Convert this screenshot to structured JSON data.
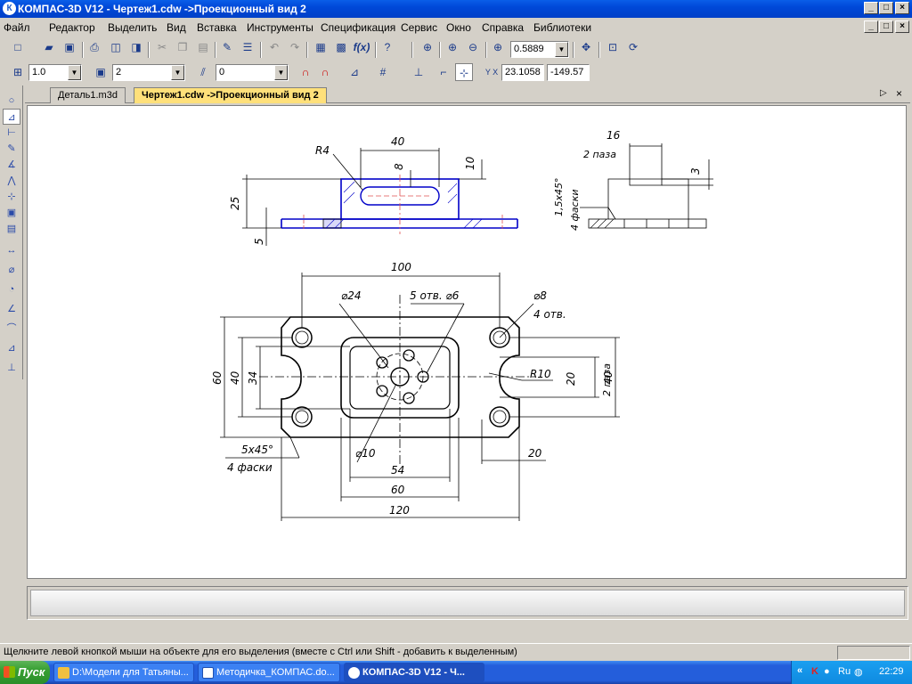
{
  "titlebar": {
    "title": "КОМПАС-3D V12 - Чертеж1.cdw ->Проекционный вид 2",
    "app_icon": "К",
    "min": "_",
    "max": "□",
    "close": "×"
  },
  "menu": [
    "Файл",
    "Редактор",
    "Выделить",
    "Вид",
    "Вставка",
    "Инструменты",
    "Спецификация",
    "Сервис",
    "Окно",
    "Справка",
    "Библиотеки"
  ],
  "toolbar": {
    "zoom_value": "0.5889"
  },
  "props": {
    "line_scale": "1.0",
    "layer": "2",
    "style": "0",
    "coord_x": "23.1058",
    "coord_y": "-149.57"
  },
  "tabs": [
    {
      "label": "Деталь1.m3d",
      "active": false
    },
    {
      "label": "Чертеж1.cdw ->Проекционный вид 2",
      "active": true
    }
  ],
  "drawing": {
    "front": {
      "d40": "40",
      "d8": "8",
      "d10": "10",
      "d25": "25",
      "d5": "5",
      "r4": "R4"
    },
    "side": {
      "d16": "16",
      "d2paza": "2 паза",
      "d3": "3",
      "chamfer": "1,5х45°",
      "chamfer_n": "4 фаски"
    },
    "plan": {
      "d100": "100",
      "d24": "⌀24",
      "holes6": "5 отв. ⌀6",
      "d8": "⌀8",
      "holes8": "4 отв.",
      "r10": "R10",
      "d20": "20",
      "paza": "2 паза",
      "d40r": "40",
      "d60": "60",
      "d40l": "40",
      "d34": "34",
      "chamfer": "5х45°",
      "chamfer_n": "4 фаски",
      "d10": "⌀10",
      "d20b": "20",
      "d54": "54",
      "d60b": "60",
      "d120": "120"
    }
  },
  "status": {
    "hint": "Щелкните левой кнопкой мыши на объекте для его выделения (вместе с Ctrl или Shift - добавить к выделенным)"
  },
  "taskbar": {
    "start": "Пуск",
    "tasks": [
      {
        "label": "D:\\Модели для Татьяны...",
        "active": false
      },
      {
        "label": "Методичка_КОМПАС.do...",
        "active": false
      },
      {
        "label": "КОМПАС-3D V12 - Ч...",
        "active": true
      }
    ],
    "lang": "Ru",
    "clock": "22:29"
  },
  "colors": {
    "accent": "#ffe07a",
    "drawing_blue": "#0000c8",
    "axis_red": "#e05050"
  }
}
